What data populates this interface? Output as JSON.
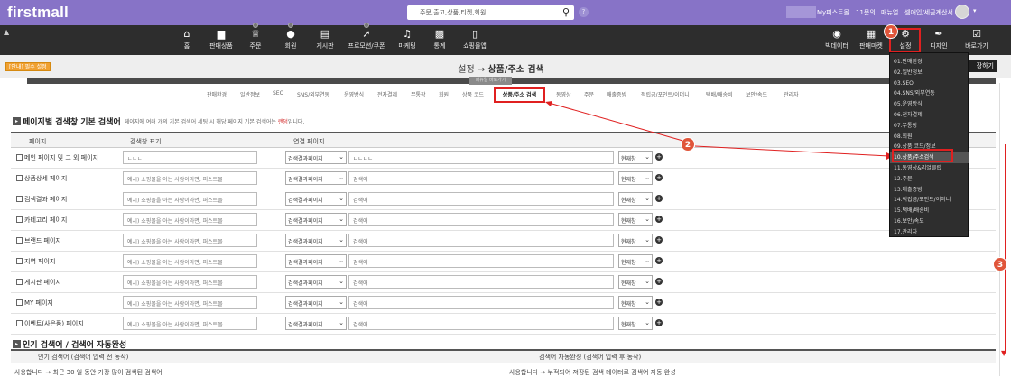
{
  "topbar": {
    "logo": "firstmall",
    "search_placeholder": "주문,출고,상품,티켓,회원",
    "help": "?",
    "links": [
      "My퍼스트몰",
      "11문의",
      "매뉴얼",
      "셈애입/세금계산서"
    ]
  },
  "nav": {
    "items": [
      {
        "label": "홈",
        "icon": "home-icon"
      },
      {
        "label": "판매상품",
        "icon": "shoe-icon"
      },
      {
        "label": "주문",
        "icon": "crown-icon"
      },
      {
        "label": "회원",
        "icon": "person-icon"
      },
      {
        "label": "게시판",
        "icon": "clipboard-icon"
      },
      {
        "label": "프로모션/쿠폰",
        "icon": "tag-icon"
      },
      {
        "label": "마케팅",
        "icon": "speaker-icon"
      },
      {
        "label": "통계",
        "icon": "bar-chart-icon"
      },
      {
        "label": "쇼핑몰앱",
        "icon": "tablet-icon"
      }
    ],
    "right_items": [
      {
        "label": "빅데이터",
        "icon": "bigdata-icon"
      },
      {
        "label": "판매마켓",
        "icon": "store-icon"
      },
      {
        "label": "설정",
        "icon": "gear-icon"
      },
      {
        "label": "디자인",
        "icon": "brush-icon"
      },
      {
        "label": "바로가기",
        "icon": "cart-icon"
      }
    ]
  },
  "subbar": {
    "notice": "[안내] 필수 설정",
    "title_prefix": "설정 →",
    "title_main": "상품/주소 검색",
    "shortcut": "장하기",
    "manual": "매뉴얼 바로가기"
  },
  "tabs": [
    "판매환경",
    "일반정보",
    "SEO",
    "SNS/외부연동",
    "운영방식",
    "전자결제",
    "무통장",
    "회원",
    "상품 코드",
    "상품/주소 검색",
    "동영상",
    "주문",
    "매출증빙",
    "적립금/포인트/이머니",
    "택배/배송비",
    "보안/속도",
    "관리자"
  ],
  "active_tab": "상품/주소 검색",
  "section1": {
    "title": "페이지별 검색창 기본 검색어",
    "desc_pre": "페이지에 여러 개의 기본 검색어 세팅 시 해당 페이지 기본 검색어는",
    "desc_hl": "랜덤",
    "desc_post": "입니다."
  },
  "table": {
    "headers": [
      "페이지",
      "검색창 표기",
      "연결 페이지"
    ],
    "rows": [
      {
        "page": "메인 페이지 및 그 외 페이지",
        "display": "ㄴㄴㄴ",
        "select": "검색결과페이지",
        "keyword": "ㄴㄴㄴㄴ",
        "window": "현재창"
      },
      {
        "page": "상품상세 페이지",
        "display": "예시) 쇼핑몰을 아는 사람이라면, 퍼스트몰",
        "select": "검색결과페이지",
        "keyword": "검색어",
        "window": "현재창"
      },
      {
        "page": "검색결과 페이지",
        "display": "예시) 쇼핑몰을 아는 사람이라면, 퍼스트몰",
        "select": "검색결과페이지",
        "keyword": "검색어",
        "window": "현재창"
      },
      {
        "page": "카테고리 페이지",
        "display": "예시) 쇼핑몰을 아는 사람이라면, 퍼스트몰",
        "select": "검색결과페이지",
        "keyword": "검색어",
        "window": "현재창"
      },
      {
        "page": "브랜드 페이지",
        "display": "예시) 쇼핑몰을 아는 사람이라면, 퍼스트몰",
        "select": "검색결과페이지",
        "keyword": "검색어",
        "window": "현재창"
      },
      {
        "page": "지역 페이지",
        "display": "예시) 쇼핑몰을 아는 사람이라면, 퍼스트몰",
        "select": "검색결과페이지",
        "keyword": "검색어",
        "window": "현재창"
      },
      {
        "page": "게시판 페이지",
        "display": "예시) 쇼핑몰을 아는 사람이라면, 퍼스트몰",
        "select": "검색결과페이지",
        "keyword": "검색어",
        "window": "현재창"
      },
      {
        "page": "MY 페이지",
        "display": "예시) 쇼핑몰을 아는 사람이라면, 퍼스트몰",
        "select": "검색결과페이지",
        "keyword": "검색어",
        "window": "현재창"
      },
      {
        "page": "이벤트(사은품) 페이지",
        "display": "예시) 쇼핑몰을 아는 사람이라면, 퍼스트몰",
        "select": "검색결과페이지",
        "keyword": "검색어",
        "window": "현재창"
      }
    ]
  },
  "section2": {
    "title": "인기 검색어 / 검색어 자동완성",
    "col1": "인기 검색어 (검색어 입력 전 동작)",
    "col2": "검색어 자동완성 (검색어 입력 후 동작)",
    "row1": "사용합니다 → 최근 30 일 동안 가장 많이 검색된 검색어",
    "row2": "사용합니다 → 누적되어 저장된 검색 데이터로 검색어 자동 완성"
  },
  "dropdown": [
    "01.판매환경",
    "02.일반정보",
    "03.SEO",
    "04.SNS/외부연동",
    "05.운영방식",
    "06.전자결제",
    "07.무통장",
    "08.회원",
    "09.상품 코드/정보",
    "10.상품/주소검색",
    "11.동영상&리얼클립",
    "12.주문",
    "13.매출증빙",
    "14.적립금/포인트/이머니",
    "15.택배/배송비",
    "16.보안/속도",
    "17.관리자"
  ],
  "badges": [
    "1",
    "2",
    "3"
  ],
  "colors": {
    "brand": "#8773c7",
    "nav": "#2d2d2d",
    "highlight": "#e02020",
    "badge": "#e0553a"
  }
}
